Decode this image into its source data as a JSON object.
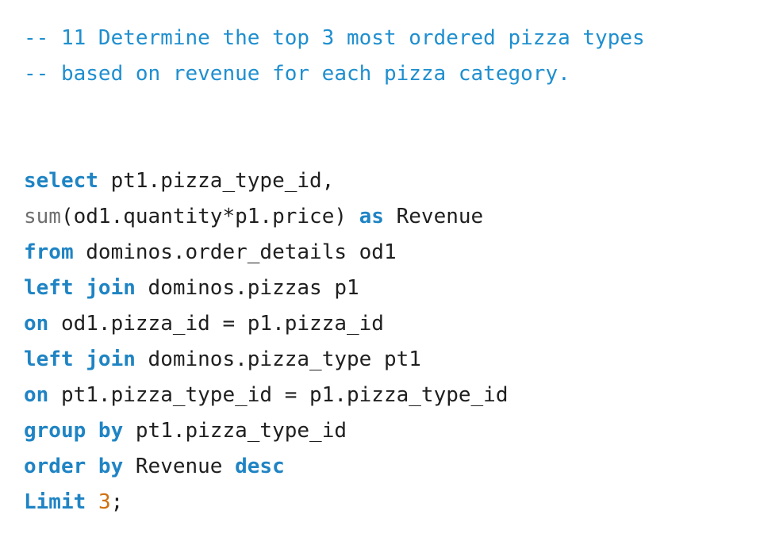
{
  "code": {
    "comment_line_1": "-- 11 Determine the top 3 most ordered pizza types",
    "comment_line_2": "-- based on revenue for each pizza category.",
    "line_select": {
      "keyword": "select",
      "rest": " pt1.pizza_type_id,"
    },
    "line_sum": {
      "function": "sum",
      "args": "(od1.quantity*p1.price)",
      "keyword": " as",
      "rest": " Revenue"
    },
    "line_from": {
      "keyword": "from",
      "rest": " dominos.order_details od1"
    },
    "line_join1": {
      "keyword": "left join",
      "rest": " dominos.pizzas p1"
    },
    "line_on1": {
      "keyword": "on",
      "rest": " od1.pizza_id = p1.pizza_id"
    },
    "line_join2": {
      "keyword": "left join",
      "rest": " dominos.pizza_type pt1"
    },
    "line_on2": {
      "keyword": "on",
      "rest": " pt1.pizza_type_id = p1.pizza_type_id"
    },
    "line_group": {
      "keyword": "group by",
      "rest": " pt1.pizza_type_id"
    },
    "line_order": {
      "keyword": "order by",
      "middle": " Revenue ",
      "keyword2": "desc"
    },
    "line_limit": {
      "keyword": "Limit",
      "space": " ",
      "number": "3",
      "end": ";"
    }
  },
  "colors": {
    "comment": "#1f8fcf",
    "keyword": "#1f84c4",
    "function": "#6f6f6f",
    "identifier": "#1f1f1f",
    "number": "#d07010",
    "background": "#ffffff"
  }
}
